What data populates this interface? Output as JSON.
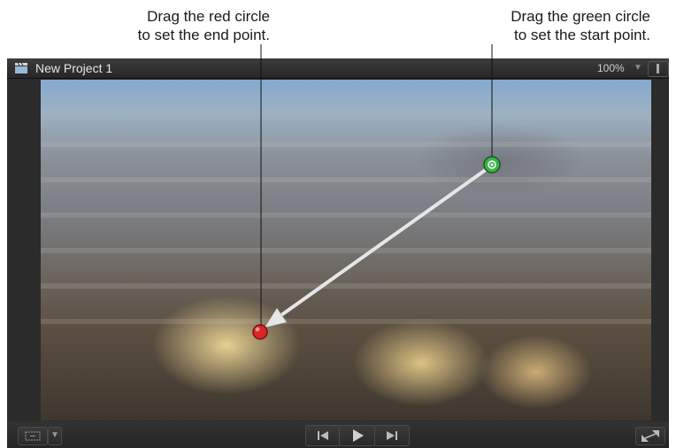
{
  "callouts": {
    "red": {
      "line1": "Drag the red circle",
      "line2": "to set the end point."
    },
    "green": {
      "line1": "Drag the green circle",
      "line2": "to set the start point."
    }
  },
  "window": {
    "title": "New Project 1",
    "zoom": "100%"
  },
  "colors": {
    "start_point": "#3cb34a",
    "end_point": "#d8262b"
  }
}
